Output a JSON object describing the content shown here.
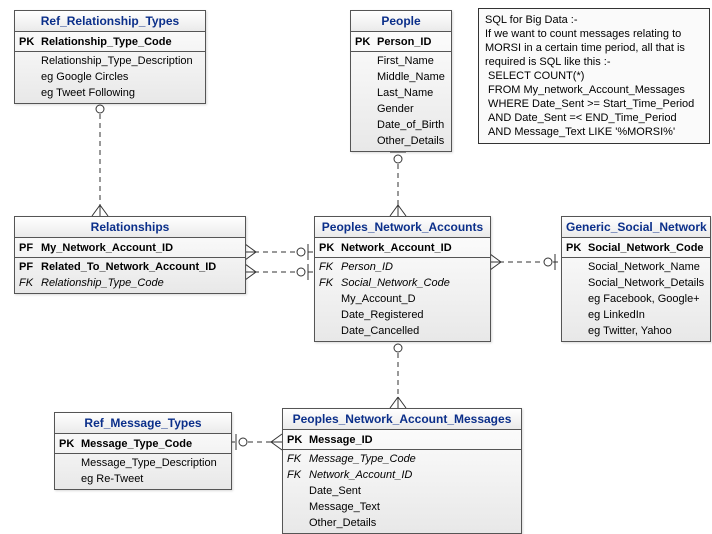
{
  "entities": {
    "ref_rel_types": {
      "title": "Ref_Relationship_Types",
      "rows": [
        {
          "key": "PK",
          "kclass": "pk",
          "name": "Relationship_Type_Code",
          "nclass": "pkname"
        },
        {
          "key": "",
          "kclass": "",
          "name": "Relationship_Type_Description",
          "nclass": ""
        },
        {
          "key": "",
          "kclass": "",
          "name": "eg Google Circles",
          "nclass": ""
        },
        {
          "key": "",
          "kclass": "",
          "name": "eg Tweet Following",
          "nclass": ""
        }
      ]
    },
    "people": {
      "title": "People",
      "rows": [
        {
          "key": "PK",
          "kclass": "pk",
          "name": "Person_ID",
          "nclass": "pkname"
        },
        {
          "key": "",
          "kclass": "",
          "name": "First_Name",
          "nclass": ""
        },
        {
          "key": "",
          "kclass": "",
          "name": "Middle_Name",
          "nclass": ""
        },
        {
          "key": "",
          "kclass": "",
          "name": "Last_Name",
          "nclass": ""
        },
        {
          "key": "",
          "kclass": "",
          "name": "Gender",
          "nclass": ""
        },
        {
          "key": "",
          "kclass": "",
          "name": "Date_of_Birth",
          "nclass": ""
        },
        {
          "key": "",
          "kclass": "",
          "name": "Other_Details",
          "nclass": ""
        }
      ]
    },
    "relationships": {
      "title": "Relationships",
      "rows": [
        {
          "key": "PF",
          "kclass": "pf",
          "name": "My_Network_Account_ID",
          "nclass": "pkname"
        },
        {
          "key": "PF",
          "kclass": "pf",
          "name": "Related_To_Network_Account_ID",
          "nclass": "pkname"
        },
        {
          "key": "FK",
          "kclass": "fk",
          "name": "Relationship_Type_Code",
          "nclass": "fkname"
        }
      ]
    },
    "accounts": {
      "title": "Peoples_Network_Accounts",
      "rows": [
        {
          "key": "PK",
          "kclass": "pk",
          "name": "Network_Account_ID",
          "nclass": "pkname"
        },
        {
          "key": "FK",
          "kclass": "fk",
          "name": "Person_ID",
          "nclass": "fkname"
        },
        {
          "key": "FK",
          "kclass": "fk",
          "name": "Social_Network_Code",
          "nclass": "fkname"
        },
        {
          "key": "",
          "kclass": "",
          "name": "My_Account_D",
          "nclass": ""
        },
        {
          "key": "",
          "kclass": "",
          "name": "Date_Registered",
          "nclass": ""
        },
        {
          "key": "",
          "kclass": "",
          "name": "Date_Cancelled",
          "nclass": ""
        }
      ]
    },
    "social_network": {
      "title": "Generic_Social_Network",
      "rows": [
        {
          "key": "PK",
          "kclass": "pk",
          "name": "Social_Network_Code",
          "nclass": "pkname"
        },
        {
          "key": "",
          "kclass": "",
          "name": "Social_Network_Name",
          "nclass": ""
        },
        {
          "key": "",
          "kclass": "",
          "name": "Social_Network_Details",
          "nclass": ""
        },
        {
          "key": "",
          "kclass": "",
          "name": "eg Facebook, Google+",
          "nclass": ""
        },
        {
          "key": "",
          "kclass": "",
          "name": "eg LinkedIn",
          "nclass": ""
        },
        {
          "key": "",
          "kclass": "",
          "name": "eg Twitter, Yahoo",
          "nclass": ""
        }
      ]
    },
    "ref_msg_types": {
      "title": "Ref_Message_Types",
      "rows": [
        {
          "key": "PK",
          "kclass": "pk",
          "name": "Message_Type_Code",
          "nclass": "pkname"
        },
        {
          "key": "",
          "kclass": "",
          "name": "Message_Type_Description",
          "nclass": ""
        },
        {
          "key": "",
          "kclass": "",
          "name": "eg Re-Tweet",
          "nclass": ""
        }
      ]
    },
    "messages": {
      "title": "Peoples_Network_Account_Messages",
      "rows": [
        {
          "key": "PK",
          "kclass": "pk",
          "name": "Message_ID",
          "nclass": "pkname"
        },
        {
          "key": "FK",
          "kclass": "fk",
          "name": "Message_Type_Code",
          "nclass": "fkname"
        },
        {
          "key": "FK",
          "kclass": "fk",
          "name": "Network_Account_ID",
          "nclass": "fkname"
        },
        {
          "key": "",
          "kclass": "",
          "name": "Date_Sent",
          "nclass": ""
        },
        {
          "key": "",
          "kclass": "",
          "name": "Message_Text",
          "nclass": ""
        },
        {
          "key": "",
          "kclass": "",
          "name": "Other_Details",
          "nclass": ""
        }
      ]
    }
  },
  "note": {
    "l0": "SQL for Big Data :-",
    "l1": "If we want to count messages relating to",
    "l2": "MORSI in a certain time period, all that is",
    "l3": "required is SQL like this :-",
    "l4": " SELECT COUNT(*)",
    "l5": " FROM My_network_Account_Messages",
    "l6": " WHERE Date_Sent >= Start_Time_Period",
    "l7": " AND Date_Sent =< END_Time_Period",
    "l8": " AND Message_Text LIKE '%MORSI%'"
  },
  "connectors": [
    {
      "from": "ref_rel_types",
      "to": "relationships",
      "type": "one-to-many-dashed"
    },
    {
      "from": "people",
      "to": "accounts",
      "type": "one-to-many-dashed"
    },
    {
      "from": "accounts",
      "to": "relationships",
      "type": "one-to-many-dashed"
    },
    {
      "from": "social_network",
      "to": "accounts",
      "type": "one-to-many-dashed"
    },
    {
      "from": "accounts",
      "to": "messages",
      "type": "one-to-many-dashed"
    },
    {
      "from": "ref_msg_types",
      "to": "messages",
      "type": "one-to-many-dashed"
    }
  ]
}
